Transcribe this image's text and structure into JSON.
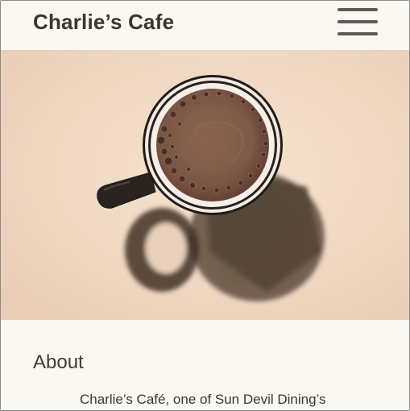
{
  "header": {
    "site_title": "Charlie’s Cafe",
    "menu_icon": "hamburger-menu-icon"
  },
  "hero": {
    "image": "coffee-cup-photo"
  },
  "about": {
    "heading": "About",
    "text": "Charlie’s Café, one of Sun Devil Dining’s"
  },
  "colors": {
    "page_background": "#f9f6f0",
    "title_text": "#3b3431",
    "menu_icon": "#5e5a58",
    "hero_background": "#efd9c4"
  }
}
